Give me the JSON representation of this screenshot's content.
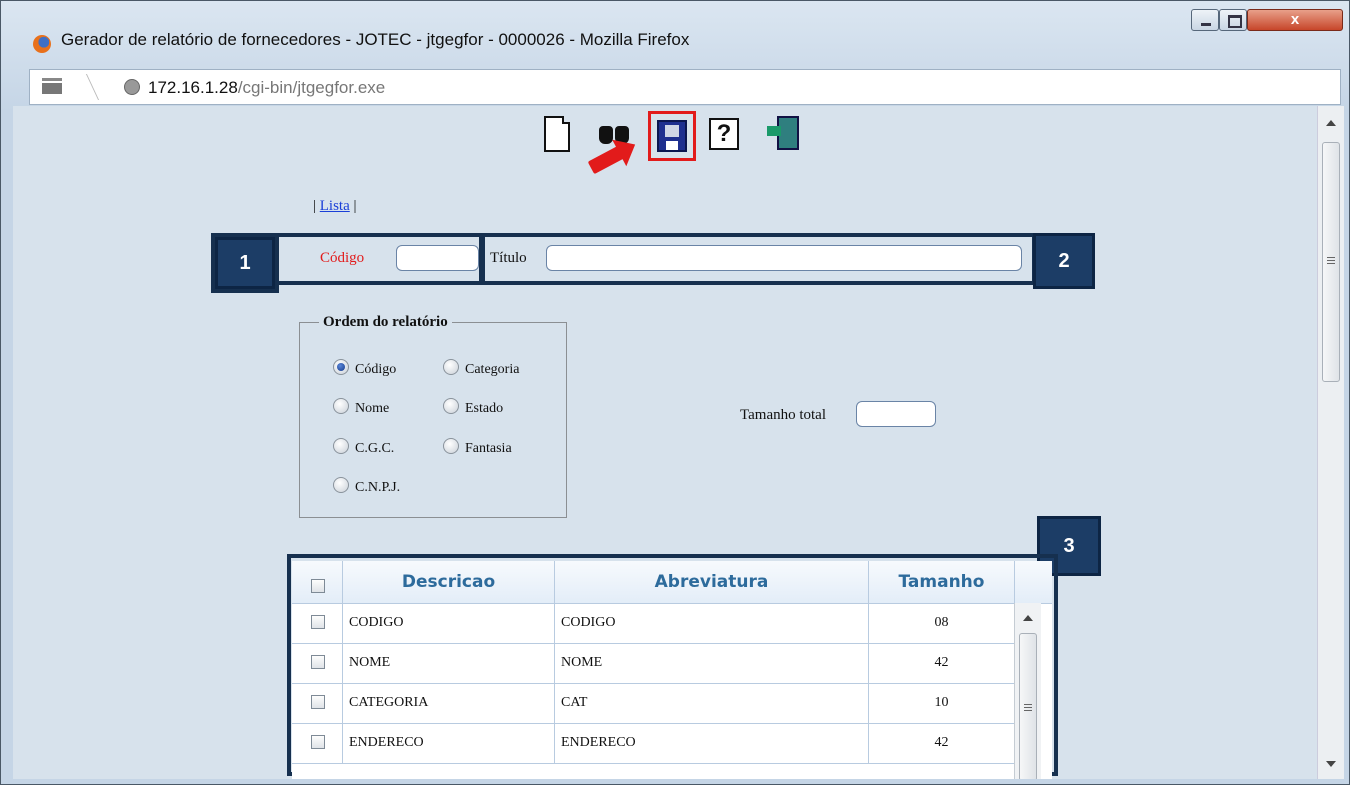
{
  "window": {
    "title": "Gerador de relatório de fornecedores - JOTEC - jtgegfor - 0000026 - Mozilla Firefox",
    "close_label": "x"
  },
  "urlbar": {
    "host": "172.16.1.28",
    "path": "/cgi-bin/jtgegfor.exe"
  },
  "toolbar": {
    "icons": [
      "new-document-icon",
      "binoculars-search-icon",
      "save-disk-icon",
      "help-icon",
      "exit-door-icon"
    ],
    "help_glyph": "?"
  },
  "nav": {
    "prefix": "| ",
    "link": "Lista",
    "suffix": " |"
  },
  "callouts": [
    "1",
    "2",
    "3"
  ],
  "form": {
    "codigo_label": "Código",
    "codigo_value": "",
    "titulo_label": "Título",
    "titulo_value": "",
    "tamanho_label": "Tamanho total",
    "tamanho_value": ""
  },
  "ordem": {
    "legend": "Ordem do relatório",
    "options": [
      "Código",
      "Categoria",
      "Nome",
      "Estado",
      "C.G.C.",
      "Fantasia",
      "C.N.P.J."
    ],
    "selected": "Código"
  },
  "grid": {
    "headers": [
      "Descricao",
      "Abreviatura",
      "Tamanho"
    ],
    "rows": [
      {
        "descricao": "CODIGO",
        "abreviatura": "CODIGO",
        "tamanho": "08"
      },
      {
        "descricao": "NOME",
        "abreviatura": "NOME",
        "tamanho": "42"
      },
      {
        "descricao": "CATEGORIA",
        "abreviatura": "CAT",
        "tamanho": "10"
      },
      {
        "descricao": "ENDERECO",
        "abreviatura": "ENDERECO",
        "tamanho": "42"
      }
    ]
  },
  "colors": {
    "highlight": "#e21b1b",
    "callout": "#1c3d66",
    "header_text": "#2d6b9c"
  }
}
